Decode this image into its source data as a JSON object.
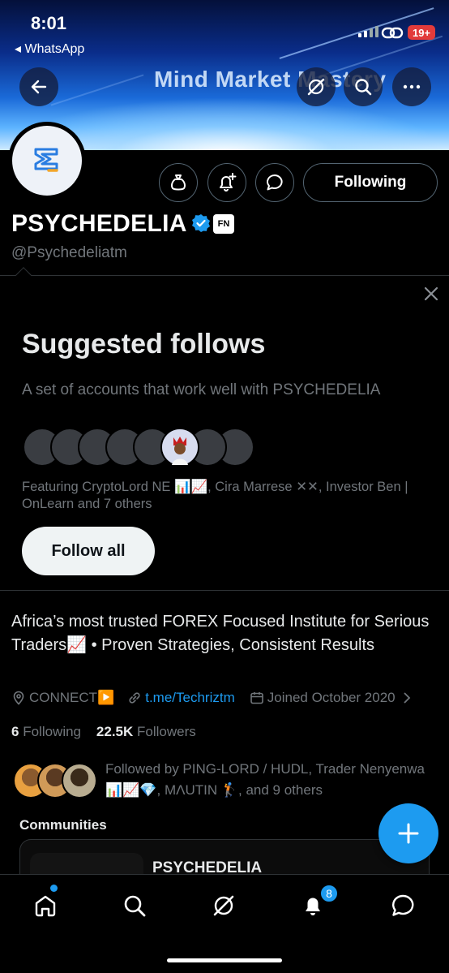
{
  "status_bar": {
    "time": "8:01",
    "back_app": "◂ WhatsApp",
    "battery": "19+"
  },
  "banner": {
    "title": "Mind  Market  Mastery"
  },
  "profile": {
    "name": "PSYCHEDELIA",
    "badge": "FN",
    "handle": "@Psychedeliatm",
    "following_button": "Following",
    "bio": "Africa’s most trusted FOREX Focused Institute for Serious Traders📈 • Proven Strategies, Consistent Results",
    "location": "CONNECT▶️",
    "website": "t.me/Techriztm",
    "joined": "Joined October 2020",
    "following_count": "6",
    "following_label": "Following",
    "followers_count": "22.5K",
    "followers_label": "Followers",
    "followed_by": "Followed by PING-LORD / HUDL, Trader Nenyenwa 📊📈💎, MΛUTIN 🏌️, and 9 others"
  },
  "suggested": {
    "title": "Suggested follows",
    "subtitle": "A set of accounts that work well with PSYCHEDELIA",
    "featuring": "Featuring CryptoLord NE 📊📈, Cira Marrese ✕✕, Investor Ben | OnLearn and 7 others",
    "follow_all": "Follow all"
  },
  "communities": {
    "label": "Communities",
    "card_name": "PSYCHEDELIA"
  },
  "nav": {
    "notifications_count": "8"
  },
  "colors": {
    "accent": "#1d9bf0",
    "background": "#000000",
    "muted": "#71767b",
    "border": "#2f3336"
  },
  "icons": [
    "back-arrow-icon",
    "grok-icon",
    "search-icon",
    "more-icon",
    "money-bag-icon",
    "notification-add-icon",
    "message-icon",
    "verified-icon",
    "close-icon",
    "location-icon",
    "link-icon",
    "calendar-icon",
    "chevron-right-icon",
    "plus-icon",
    "home-icon",
    "bell-icon"
  ]
}
